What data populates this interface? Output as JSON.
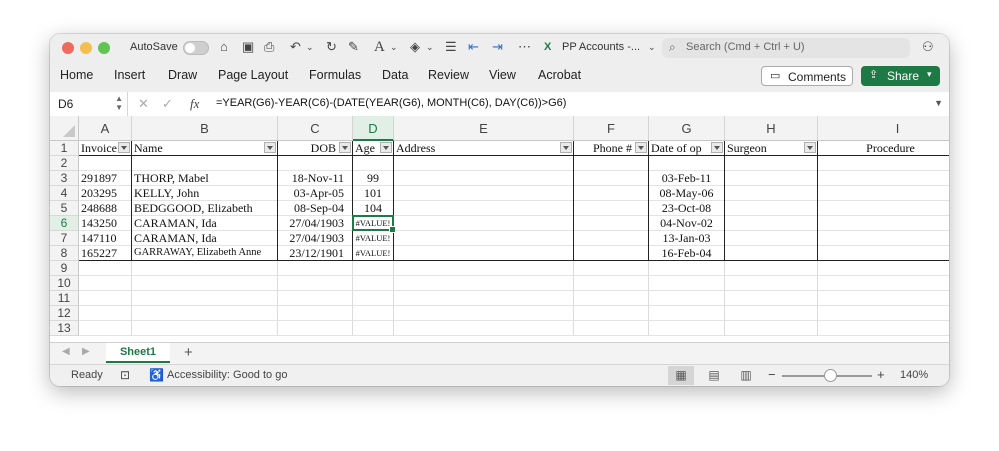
{
  "titlebar": {
    "autosave_label": "AutoSave",
    "doc_title": "PP Accounts -...",
    "search_placeholder": "Search (Cmd + Ctrl + U)"
  },
  "ribbon": {
    "tabs": [
      "Home",
      "Insert",
      "Draw",
      "Page Layout",
      "Formulas",
      "Data",
      "Review",
      "View",
      "Acrobat"
    ],
    "comments_label": "Comments",
    "share_label": "Share"
  },
  "formula_bar": {
    "name_box": "D6",
    "formula": "=YEAR(G6)-YEAR(C6)-(DATE(YEAR(G6), MONTH(C6), DAY(C6))>G6)"
  },
  "grid": {
    "columns": [
      "A",
      "B",
      "C",
      "D",
      "E",
      "F",
      "G",
      "H",
      "I"
    ],
    "rows": [
      "1",
      "2",
      "3",
      "4",
      "5",
      "6",
      "7",
      "8",
      "9",
      "10",
      "11",
      "12",
      "13"
    ],
    "active_column": "D",
    "active_row": "6",
    "headers": [
      "Invoice",
      "Name",
      "DOB",
      "Age",
      "Address",
      "Phone #",
      "Date of op",
      "Surgeon",
      "Procedure"
    ],
    "data": [
      [
        "",
        "",
        "",
        "",
        "",
        "",
        "",
        "",
        ""
      ],
      [
        "291897",
        "THORP, Mabel",
        "18-Nov-11",
        "99",
        "",
        "",
        "03-Feb-11",
        "",
        ""
      ],
      [
        "203295",
        "KELLY, John",
        "03-Apr-05",
        "101",
        "",
        "",
        "08-May-06",
        "",
        ""
      ],
      [
        "248688",
        "BEDGGOOD, Elizabeth",
        "08-Sep-04",
        "104",
        "",
        "",
        "23-Oct-08",
        "",
        ""
      ],
      [
        "143250",
        "CARAMAN, Ida",
        "27/04/1903",
        "#VALUE!",
        "",
        "",
        "04-Nov-02",
        "",
        ""
      ],
      [
        "147110",
        "CARAMAN, Ida",
        "27/04/1903",
        "#VALUE!",
        "",
        "",
        "13-Jan-03",
        "",
        ""
      ],
      [
        "165227",
        "GARRAWAY, Elizabeth Anne",
        "23/12/1901",
        "#VALUE!",
        "",
        "",
        "16-Feb-04",
        "",
        ""
      ]
    ]
  },
  "sheets": {
    "active": "Sheet1"
  },
  "status": {
    "ready": "Ready",
    "accessibility": "Accessibility: Good to go",
    "zoom": "140%"
  },
  "colors": {
    "accent": "#1e7a44"
  }
}
